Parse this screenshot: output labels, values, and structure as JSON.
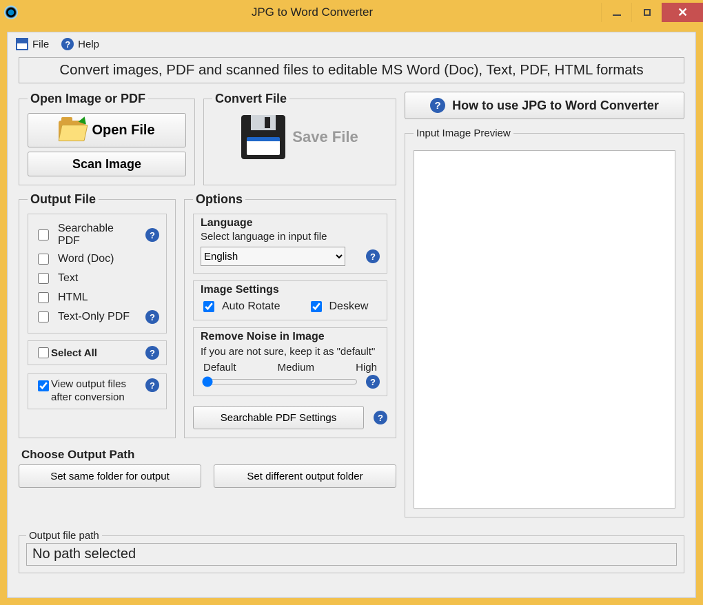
{
  "window": {
    "title": "JPG to Word Converter"
  },
  "menu": {
    "file": "File",
    "help": "Help"
  },
  "banner": "Convert images, PDF and scanned files to editable MS Word (Doc), Text, PDF, HTML formats",
  "open": {
    "legend": "Open Image or PDF",
    "open_file": "Open File",
    "scan_image": "Scan Image"
  },
  "convert": {
    "legend": "Convert File",
    "save_file": "Save File"
  },
  "output": {
    "legend": "Output File",
    "searchable_pdf": "Searchable PDF",
    "word_doc": "Word (Doc)",
    "text": "Text",
    "html": "HTML",
    "text_only_pdf": "Text-Only PDF",
    "select_all": "Select All",
    "view_after": "View output files after conversion",
    "view_after_checked": true
  },
  "options": {
    "legend": "Options",
    "language": {
      "title": "Language",
      "hint": "Select language in input file",
      "value": "English"
    },
    "image_settings": {
      "title": "Image Settings",
      "auto_rotate": "Auto Rotate",
      "auto_rotate_checked": true,
      "deskew": "Deskew",
      "deskew_checked": true
    },
    "noise": {
      "title": "Remove Noise in Image",
      "hint": "If you are not sure, keep it as \"default\"",
      "labels": {
        "low": "Default",
        "mid": "Medium",
        "high": "High"
      },
      "value": 0,
      "min": 0,
      "max": 2
    },
    "pdf_settings_btn": "Searchable PDF Settings"
  },
  "choose_path": {
    "title": "Choose Output Path",
    "same_folder": "Set same folder for output",
    "diff_folder": "Set different output folder"
  },
  "output_path": {
    "legend": "Output file path",
    "value": "No path selected"
  },
  "right": {
    "howto": "How to use JPG to Word Converter",
    "preview_legend": "Input Image Preview"
  }
}
